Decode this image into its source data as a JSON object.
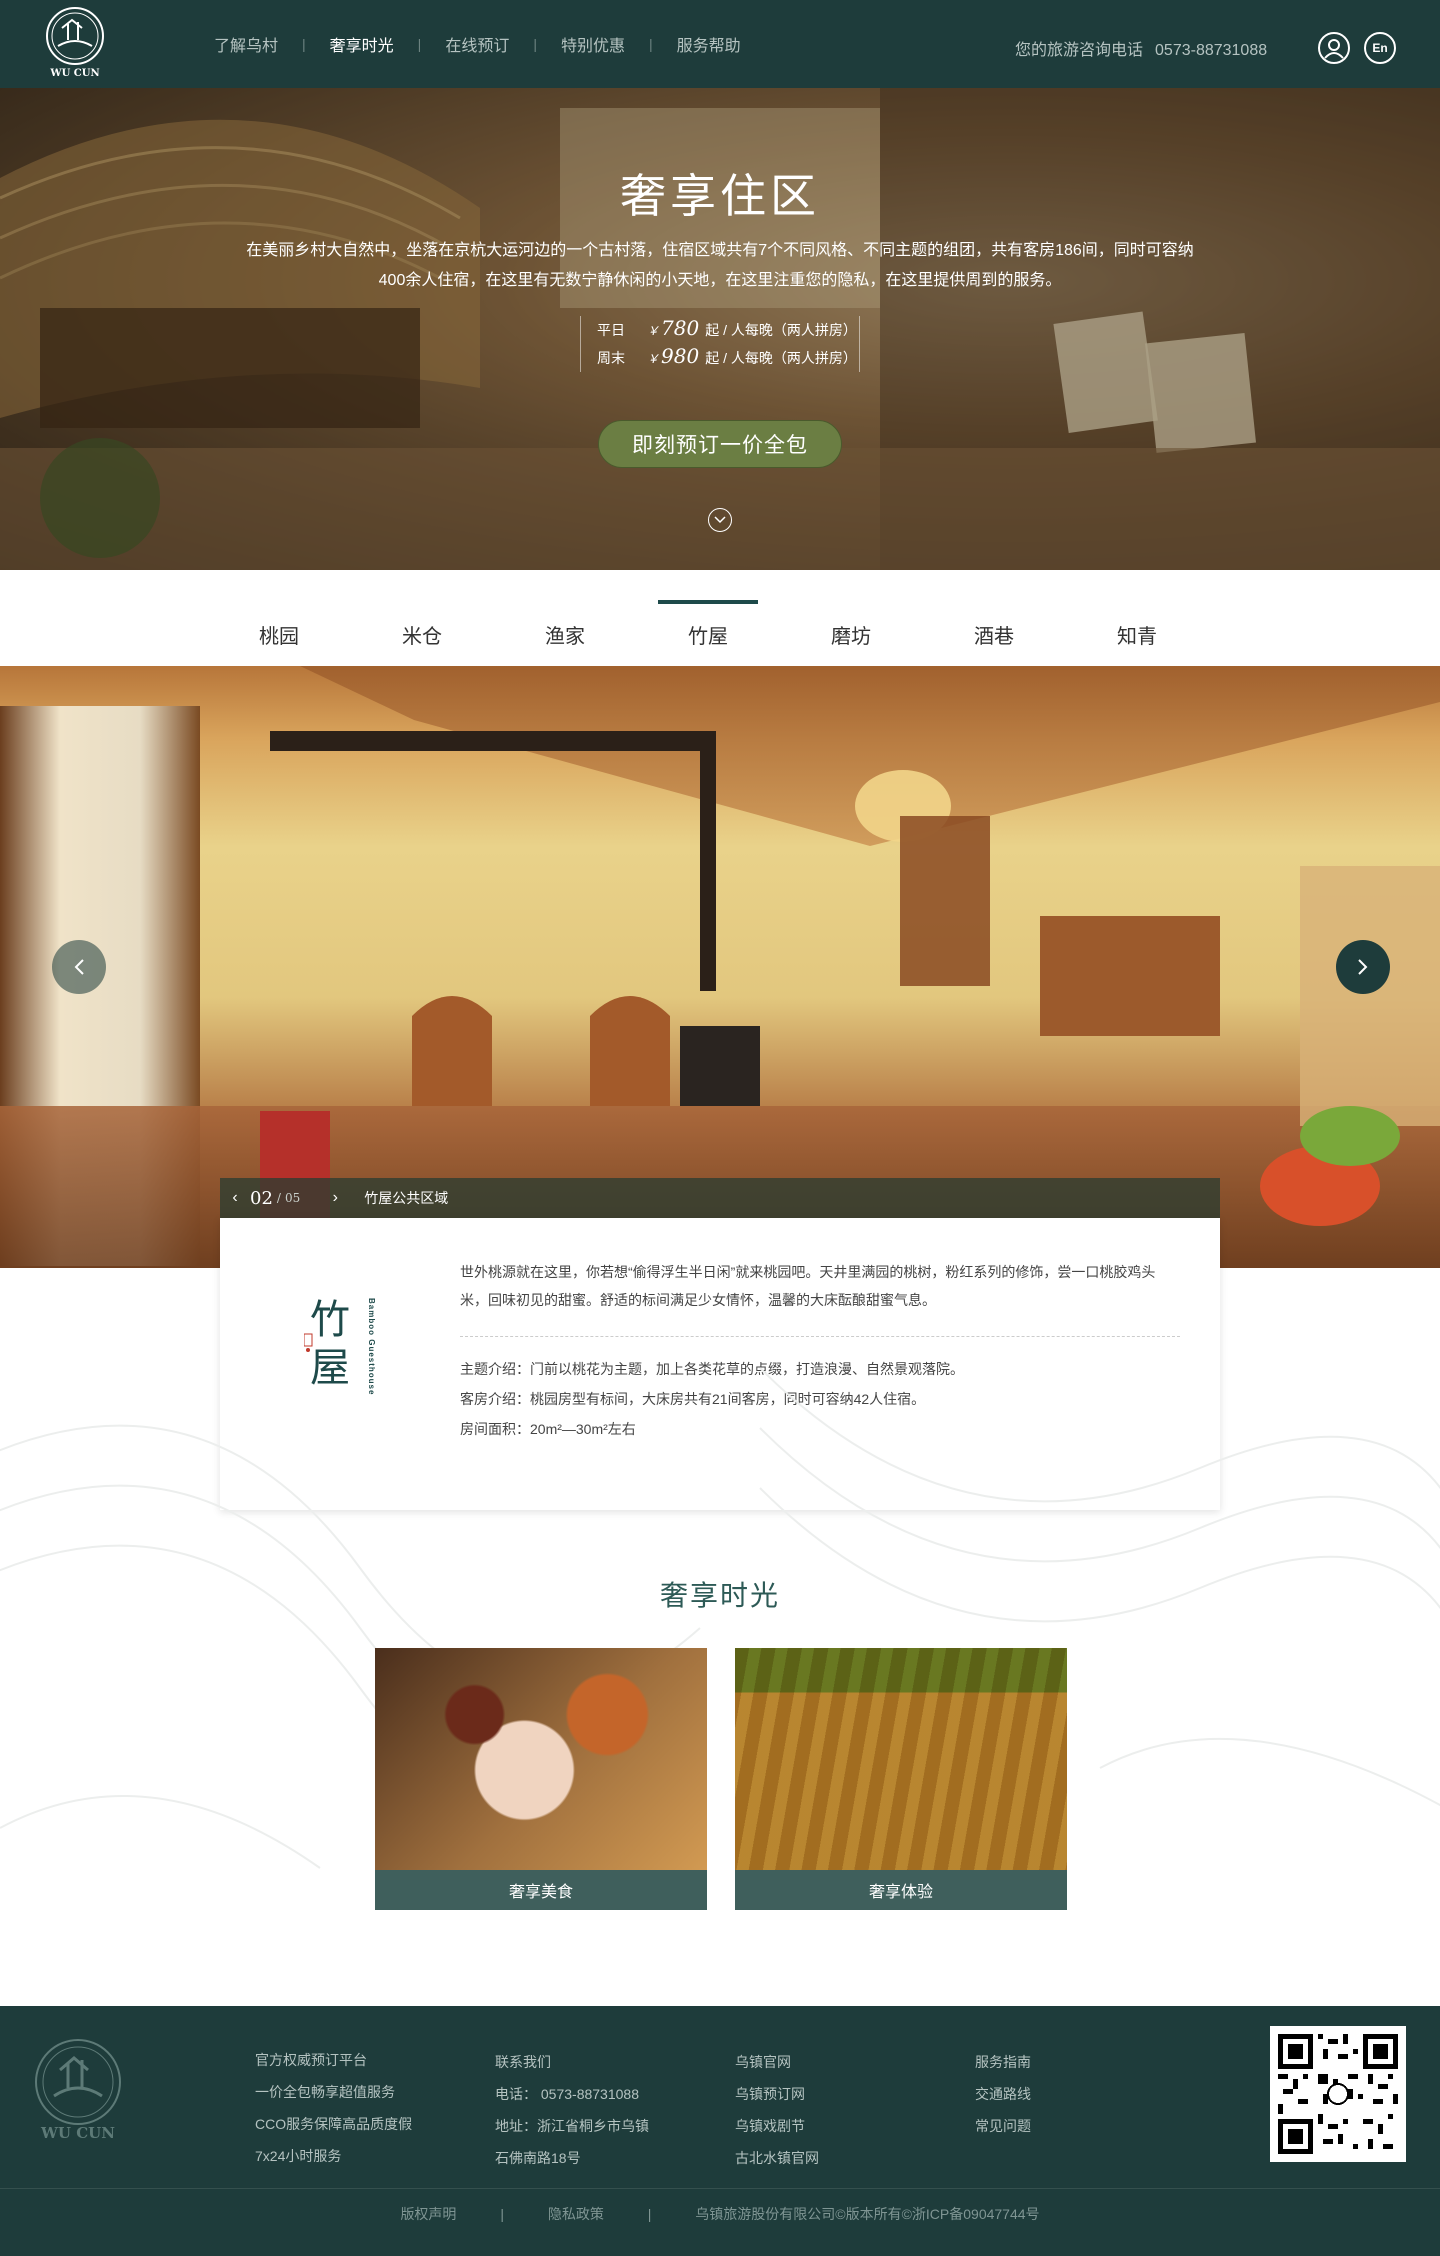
{
  "colors": {
    "primary": "#1e3c3b",
    "accent_button": "#6b7e43",
    "title_green": "#2d5a56",
    "card_label_bg": "#3f5f5c"
  },
  "header": {
    "logo_text": "WU CUN",
    "logo_mark": "乌村",
    "nav": [
      "了解乌村",
      "奢享时光",
      "在线预订",
      "特别优惠",
      "服务帮助"
    ],
    "nav_active_index": 1,
    "hotline_label": "您的旅游咨询电话",
    "hotline_number": "0573-88731088",
    "lang_label": "En"
  },
  "hero": {
    "title": "奢享住区",
    "description": "在美丽乡村大自然中，坐落在京杭大运河边的一个古村落，住宿区域共有7个不同风格、不同主题的组团，共有客房186间，同时可容纳400余人住宿，在这里有无数宁静休闲的小天地，在这里注重您的隐私，在这里提供周到的服务。",
    "prices": [
      {
        "label": "平日",
        "currency": "￥",
        "value": "780",
        "suffix": "起 / 人每晚（两人拼房）"
      },
      {
        "label": "周末",
        "currency": "￥",
        "value": "980",
        "suffix": "起 / 人每晚（两人拼房）"
      }
    ],
    "book_button": "即刻预订一价全包"
  },
  "tabs": {
    "items": [
      "桃园",
      "米仓",
      "渔家",
      "竹屋",
      "磨坊",
      "酒巷",
      "知青"
    ],
    "active_index": 3
  },
  "gallery": {
    "current": "02",
    "separator": "/",
    "total": "05",
    "caption": "竹屋公共区域"
  },
  "info": {
    "brand_title": "竹屋",
    "brand_subtitle": "Bamboo Guesthouse",
    "description": "世外桃源就在这里，你若想“偷得浮生半日闲”就来桃园吧。天井里满园的桃树，粉红系列的修饰，尝一口桃胶鸡头米，回味初见的甜蜜。舒适的标间满足少女情怀，温馨的大床酝酿甜蜜气息。",
    "details": [
      "主题介绍：门前以桃花为主题，加上各类花草的点缀，打造浪漫、自然景观落院。",
      "客房介绍：桃园房型有标间，大床房共有21间客房，同时可容纳42人住宿。",
      "房间面积：20m²—30m²左右"
    ]
  },
  "luxury": {
    "title": "奢享时光",
    "cards": [
      {
        "label": "奢享美食"
      },
      {
        "label": "奢享体验"
      }
    ]
  },
  "footer": {
    "logo_text": "WU CUN",
    "logo_mark": "乌村",
    "col1": [
      "官方权威预订平台",
      "一价全包畅享超值服务",
      "CCO服务保障高品质度假",
      "7x24小时服务"
    ],
    "col2": [
      "联系我们",
      "电话： 0573-88731088",
      "地址：浙江省桐乡市乌镇",
      "石佛南路18号"
    ],
    "col3": [
      "乌镇官网",
      "乌镇预订网",
      "乌镇戏剧节",
      "古北水镇官网"
    ],
    "col4": [
      "服务指南",
      "交通路线",
      "常见问题"
    ],
    "bottom": [
      "版权声明",
      "|",
      "隐私政策",
      "|",
      "乌镇旅游股份有限公司©版本所有©浙ICP备09047744号"
    ]
  }
}
